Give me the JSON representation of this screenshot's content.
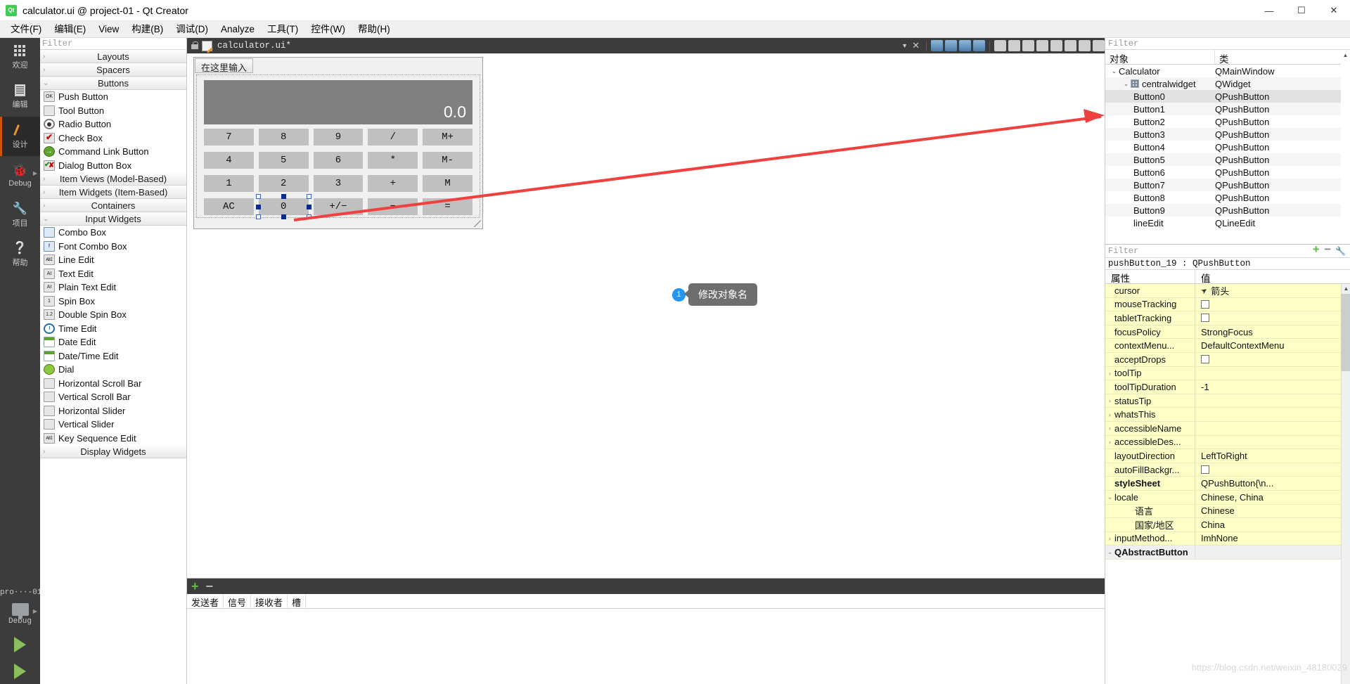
{
  "window": {
    "title": "calculator.ui @ project-01 - Qt Creator",
    "app_icon": "qt-logo-icon",
    "minimize": "—",
    "maximize": "☐",
    "close": "✕"
  },
  "menubar": {
    "items": [
      {
        "label": "文件(F)",
        "name": "menu-file"
      },
      {
        "label": "编辑(E)",
        "name": "menu-edit"
      },
      {
        "label": "View",
        "name": "menu-view"
      },
      {
        "label": "构建(B)",
        "name": "menu-build"
      },
      {
        "label": "调试(D)",
        "name": "menu-debug"
      },
      {
        "label": "Analyze",
        "name": "menu-analyze"
      },
      {
        "label": "工具(T)",
        "name": "menu-tools"
      },
      {
        "label": "控件(W)",
        "name": "menu-widgets"
      },
      {
        "label": "帮助(H)",
        "name": "menu-help"
      }
    ]
  },
  "modebar": {
    "items": [
      {
        "label": "欢迎",
        "icon": "grid-icon",
        "name": "mode-welcome",
        "selected": false
      },
      {
        "label": "编辑",
        "icon": "document-icon",
        "name": "mode-edit",
        "selected": false
      },
      {
        "label": "设计",
        "icon": "pencil-icon",
        "name": "mode-design",
        "selected": true
      },
      {
        "label": "Debug",
        "icon": "bug-icon",
        "name": "mode-debug",
        "selected": false
      },
      {
        "label": "项目",
        "icon": "wrench-icon",
        "name": "mode-projects",
        "selected": false
      },
      {
        "label": "帮助",
        "icon": "help-icon",
        "name": "mode-help",
        "selected": false
      }
    ],
    "bottom": {
      "project": "pro···-01",
      "kit_icon": "monitor-icon",
      "build_config": "Debug",
      "run_icon": "run-triangle-icon",
      "debug_icon": "run-debug-icon"
    }
  },
  "widgetbox": {
    "filter_placeholder": "Filter",
    "groups": [
      {
        "label": "Layouts",
        "expanded": false,
        "name": "group-layouts",
        "items": []
      },
      {
        "label": "Spacers",
        "expanded": false,
        "name": "group-spacers",
        "items": []
      },
      {
        "label": "Buttons",
        "expanded": true,
        "name": "group-buttons",
        "items": [
          {
            "label": "Push Button",
            "icon": "push-button-icon",
            "glyph": "OK"
          },
          {
            "label": "Tool Button",
            "icon": "tool-button-icon",
            "glyph": ""
          },
          {
            "label": "Radio Button",
            "icon": "radio-button-icon",
            "glyph": ""
          },
          {
            "label": "Check Box",
            "icon": "check-box-icon",
            "glyph": ""
          },
          {
            "label": "Command Link Button",
            "icon": "command-link-button-icon",
            "glyph": "→"
          },
          {
            "label": "Dialog Button Box",
            "icon": "dialog-button-box-icon",
            "glyph": ""
          }
        ]
      },
      {
        "label": "Item Views (Model-Based)",
        "expanded": false,
        "name": "group-item-views",
        "items": []
      },
      {
        "label": "Item Widgets (Item-Based)",
        "expanded": false,
        "name": "group-item-widgets",
        "items": []
      },
      {
        "label": "Containers",
        "expanded": false,
        "name": "group-containers",
        "items": []
      },
      {
        "label": "Input Widgets",
        "expanded": true,
        "name": "group-input-widgets",
        "items": [
          {
            "label": "Combo Box",
            "icon": "combo-box-icon",
            "glyph": ""
          },
          {
            "label": "Font Combo Box",
            "icon": "font-combo-box-icon",
            "glyph": "f"
          },
          {
            "label": "Line Edit",
            "icon": "line-edit-icon",
            "glyph": "ABI"
          },
          {
            "label": "Text Edit",
            "icon": "text-edit-icon",
            "glyph": "AI"
          },
          {
            "label": "Plain Text Edit",
            "icon": "plain-text-edit-icon",
            "glyph": "AI"
          },
          {
            "label": "Spin Box",
            "icon": "spin-box-icon",
            "glyph": "1"
          },
          {
            "label": "Double Spin Box",
            "icon": "double-spin-box-icon",
            "glyph": "1.2"
          },
          {
            "label": "Time Edit",
            "icon": "time-edit-icon",
            "glyph": ""
          },
          {
            "label": "Date Edit",
            "icon": "date-edit-icon",
            "glyph": ""
          },
          {
            "label": "Date/Time Edit",
            "icon": "date-time-edit-icon",
            "glyph": ""
          },
          {
            "label": "Dial",
            "icon": "dial-icon",
            "glyph": ""
          },
          {
            "label": "Horizontal Scroll Bar",
            "icon": "horizontal-scroll-bar-icon",
            "glyph": ""
          },
          {
            "label": "Vertical Scroll Bar",
            "icon": "vertical-scroll-bar-icon",
            "glyph": ""
          },
          {
            "label": "Horizontal Slider",
            "icon": "horizontal-slider-icon",
            "glyph": ""
          },
          {
            "label": "Vertical Slider",
            "icon": "vertical-slider-icon",
            "glyph": ""
          },
          {
            "label": "Key Sequence Edit",
            "icon": "key-sequence-edit-icon",
            "glyph": "ABI"
          }
        ]
      },
      {
        "label": "Display Widgets",
        "expanded": false,
        "name": "group-display-widgets",
        "items": []
      }
    ]
  },
  "editor_toolbar": {
    "lock_icon": "unlocked-icon",
    "file_icon": "ui-file-icon",
    "filename": "calculator.ui*",
    "dropdown_icon": "chevron-down-icon",
    "close_icon": "close-icon",
    "actions": [
      "edit-widgets-icon",
      "edit-signals-icon",
      "edit-buddies-icon",
      "edit-tab-order-icon",
      "layout-horizontal-icon",
      "layout-vertical-icon",
      "layout-splitter-h-icon",
      "layout-splitter-v-icon",
      "layout-form-icon",
      "layout-grid-icon",
      "break-layout-icon",
      "adjust-size-icon"
    ]
  },
  "form": {
    "menu_placeholder": "在这里输入",
    "display_value": "0.0",
    "keys": [
      {
        "label": "7",
        "selected": false
      },
      {
        "label": "8",
        "selected": false
      },
      {
        "label": "9",
        "selected": false
      },
      {
        "label": "/",
        "selected": false
      },
      {
        "label": "M+",
        "selected": false
      },
      {
        "label": "4",
        "selected": false
      },
      {
        "label": "5",
        "selected": false
      },
      {
        "label": "6",
        "selected": false
      },
      {
        "label": "*",
        "selected": false
      },
      {
        "label": "M-",
        "selected": false
      },
      {
        "label": "1",
        "selected": false
      },
      {
        "label": "2",
        "selected": false
      },
      {
        "label": "3",
        "selected": false
      },
      {
        "label": "+",
        "selected": false
      },
      {
        "label": "M",
        "selected": false
      },
      {
        "label": "AC",
        "selected": false
      },
      {
        "label": "0",
        "selected": true
      },
      {
        "label": "+/−",
        "selected": false
      },
      {
        "label": "−",
        "selected": false
      },
      {
        "label": "=",
        "selected": false
      }
    ]
  },
  "annotation": {
    "badge": "1",
    "text": "修改对象名",
    "arrow_color": "#f0413f"
  },
  "signal_editor": {
    "add_icon": "plus-icon",
    "remove_icon": "minus-icon",
    "columns": [
      "发送者",
      "信号",
      "接收者",
      "槽"
    ],
    "rows": []
  },
  "object_inspector": {
    "filter_placeholder": "Filter",
    "columns": [
      "对象",
      "类"
    ],
    "rows": [
      {
        "name": "Calculator",
        "class": "QMainWindow",
        "depth": 0,
        "chevron": "expanded",
        "icon": "",
        "selected": false
      },
      {
        "name": "centralwidget",
        "class": "QWidget",
        "depth": 1,
        "chevron": "expanded",
        "icon": "widget-icon",
        "selected": false
      },
      {
        "name": "Button0",
        "class": "QPushButton",
        "depth": 2,
        "chevron": "",
        "icon": "",
        "selected": true
      },
      {
        "name": "Button1",
        "class": "QPushButton",
        "depth": 2,
        "chevron": "",
        "icon": "",
        "selected": false
      },
      {
        "name": "Button2",
        "class": "QPushButton",
        "depth": 2,
        "chevron": "",
        "icon": "",
        "selected": false
      },
      {
        "name": "Button3",
        "class": "QPushButton",
        "depth": 2,
        "chevron": "",
        "icon": "",
        "selected": false
      },
      {
        "name": "Button4",
        "class": "QPushButton",
        "depth": 2,
        "chevron": "",
        "icon": "",
        "selected": false
      },
      {
        "name": "Button5",
        "class": "QPushButton",
        "depth": 2,
        "chevron": "",
        "icon": "",
        "selected": false
      },
      {
        "name": "Button6",
        "class": "QPushButton",
        "depth": 2,
        "chevron": "",
        "icon": "",
        "selected": false
      },
      {
        "name": "Button7",
        "class": "QPushButton",
        "depth": 2,
        "chevron": "",
        "icon": "",
        "selected": false
      },
      {
        "name": "Button8",
        "class": "QPushButton",
        "depth": 2,
        "chevron": "",
        "icon": "",
        "selected": false
      },
      {
        "name": "Button9",
        "class": "QPushButton",
        "depth": 2,
        "chevron": "",
        "icon": "",
        "selected": false
      },
      {
        "name": "lineEdit",
        "class": "QLineEdit",
        "depth": 2,
        "chevron": "",
        "icon": "",
        "selected": false
      }
    ]
  },
  "property_editor": {
    "filter_placeholder": "Filter",
    "add_icon": "plus-icon",
    "remove_icon": "minus-icon",
    "config_icon": "wrench-icon",
    "object_header": "pushButton_19 : QPushButton",
    "columns": [
      "属性",
      "值"
    ],
    "rows": [
      {
        "name": "cursor",
        "value": "箭头",
        "type": "cursor",
        "chevron": "",
        "indent": 1,
        "bold": false
      },
      {
        "name": "mouseTracking",
        "value": "",
        "type": "checkbox",
        "checked": false,
        "chevron": "",
        "indent": 1,
        "bold": false
      },
      {
        "name": "tabletTracking",
        "value": "",
        "type": "checkbox",
        "checked": false,
        "chevron": "",
        "indent": 1,
        "bold": false
      },
      {
        "name": "focusPolicy",
        "value": "StrongFocus",
        "type": "text",
        "chevron": "",
        "indent": 1,
        "bold": false
      },
      {
        "name": "contextMenu...",
        "value": "DefaultContextMenu",
        "type": "text",
        "chevron": "",
        "indent": 1,
        "bold": false
      },
      {
        "name": "acceptDrops",
        "value": "",
        "type": "checkbox",
        "checked": false,
        "chevron": "",
        "indent": 1,
        "bold": false
      },
      {
        "name": "toolTip",
        "value": "",
        "type": "text",
        "chevron": "collapsed",
        "indent": 0,
        "bold": false
      },
      {
        "name": "toolTipDuration",
        "value": "-1",
        "type": "text",
        "chevron": "",
        "indent": 1,
        "bold": false
      },
      {
        "name": "statusTip",
        "value": "",
        "type": "text",
        "chevron": "collapsed",
        "indent": 0,
        "bold": false
      },
      {
        "name": "whatsThis",
        "value": "",
        "type": "text",
        "chevron": "collapsed",
        "indent": 0,
        "bold": false
      },
      {
        "name": "accessibleName",
        "value": "",
        "type": "text",
        "chevron": "collapsed",
        "indent": 0,
        "bold": false
      },
      {
        "name": "accessibleDes...",
        "value": "",
        "type": "text",
        "chevron": "collapsed",
        "indent": 0,
        "bold": false
      },
      {
        "name": "layoutDirection",
        "value": "LeftToRight",
        "type": "text",
        "chevron": "",
        "indent": 1,
        "bold": false
      },
      {
        "name": "autoFillBackgr...",
        "value": "",
        "type": "checkbox",
        "checked": false,
        "chevron": "",
        "indent": 1,
        "bold": false
      },
      {
        "name": "styleSheet",
        "value": "QPushButton{\\n...",
        "type": "text",
        "chevron": "",
        "indent": 1,
        "bold": true
      },
      {
        "name": "locale",
        "value": "Chinese, China",
        "type": "text",
        "chevron": "expanded",
        "indent": 0,
        "bold": false
      },
      {
        "name": "语言",
        "value": "Chinese",
        "type": "text",
        "chevron": "",
        "indent": 2,
        "bold": false
      },
      {
        "name": "国家/地区",
        "value": "China",
        "type": "text",
        "chevron": "",
        "indent": 2,
        "bold": false
      },
      {
        "name": "inputMethod...",
        "value": "ImhNone",
        "type": "text",
        "chevron": "collapsed",
        "indent": 0,
        "bold": false
      },
      {
        "name": "QAbstractButton",
        "value": "",
        "type": "group",
        "chevron": "expanded",
        "indent": 0,
        "bold": true
      }
    ],
    "watermark": "https://blog.csdn.net/weixin_48180029"
  }
}
